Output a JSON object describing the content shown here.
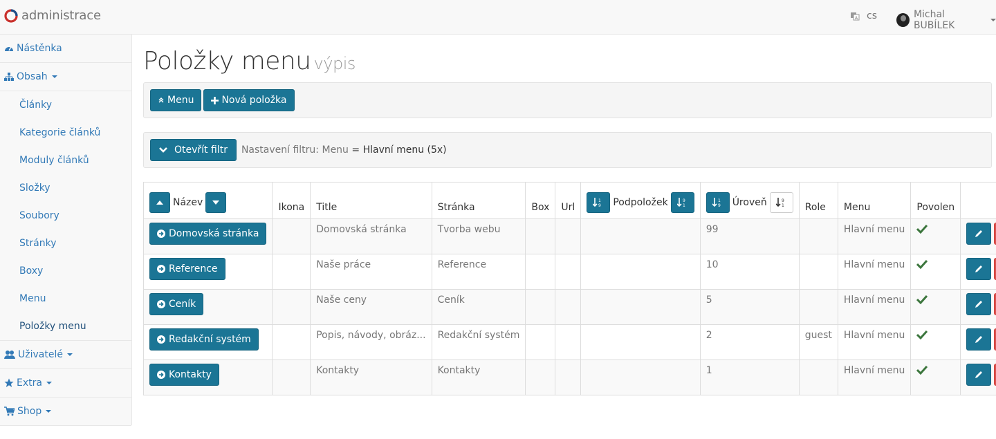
{
  "app": {
    "brand": "administrace",
    "lang": "cs",
    "user": "Michal BUBÍLEK"
  },
  "sidebar": {
    "dashboard": "Nástěnka",
    "content": "Obsah",
    "content_items": [
      "Články",
      "Kategorie článků",
      "Moduly článků",
      "Složky",
      "Soubory",
      "Stránky",
      "Boxy",
      "Menu",
      "Položky menu"
    ],
    "users": "Uživatelé",
    "extra": "Extra",
    "shop": "Shop"
  },
  "page": {
    "title": "Položky menu",
    "subtitle": "výpis"
  },
  "toolbar": {
    "menu_label": "Menu",
    "new_label": "Nová položka"
  },
  "filter": {
    "open_label": "Otevřít filtr",
    "settings_label": "Nastavení filtru:",
    "field": "Menu",
    "eq": "=",
    "value": "Hlavní menu (5x)"
  },
  "table": {
    "headers": {
      "name": "Název",
      "icon": "Ikona",
      "title": "Title",
      "page": "Stránka",
      "box": "Box",
      "url": "Url",
      "subitems": "Podpoložek",
      "level": "Úroveň",
      "role": "Role",
      "menu": "Menu",
      "enabled": "Povolen"
    },
    "rows": [
      {
        "name": "Domovská stránka",
        "title": "Domovská stránka",
        "page": "Tvorba webu",
        "level": "99",
        "role": "",
        "menu": "Hlavní menu",
        "enabled": true
      },
      {
        "name": "Reference",
        "title": "Naše práce",
        "page": "Reference",
        "level": "10",
        "role": "",
        "menu": "Hlavní menu",
        "enabled": true
      },
      {
        "name": "Ceník",
        "title": "Naše ceny",
        "page": "Ceník",
        "level": "5",
        "role": "",
        "menu": "Hlavní menu",
        "enabled": true
      },
      {
        "name": "Redakční systém",
        "title": "Popis, návody, obráz...",
        "page": "Redakční systém",
        "level": "2",
        "role": "guest",
        "menu": "Hlavní menu",
        "enabled": true
      },
      {
        "name": "Kontakty",
        "title": "Kontakty",
        "page": "Kontakty",
        "level": "1",
        "role": "",
        "menu": "Hlavní menu",
        "enabled": true
      }
    ]
  },
  "colors": {
    "primary": "#1b7595",
    "danger": "#d9534f",
    "success": "#3c763d",
    "link": "#337ab7"
  }
}
